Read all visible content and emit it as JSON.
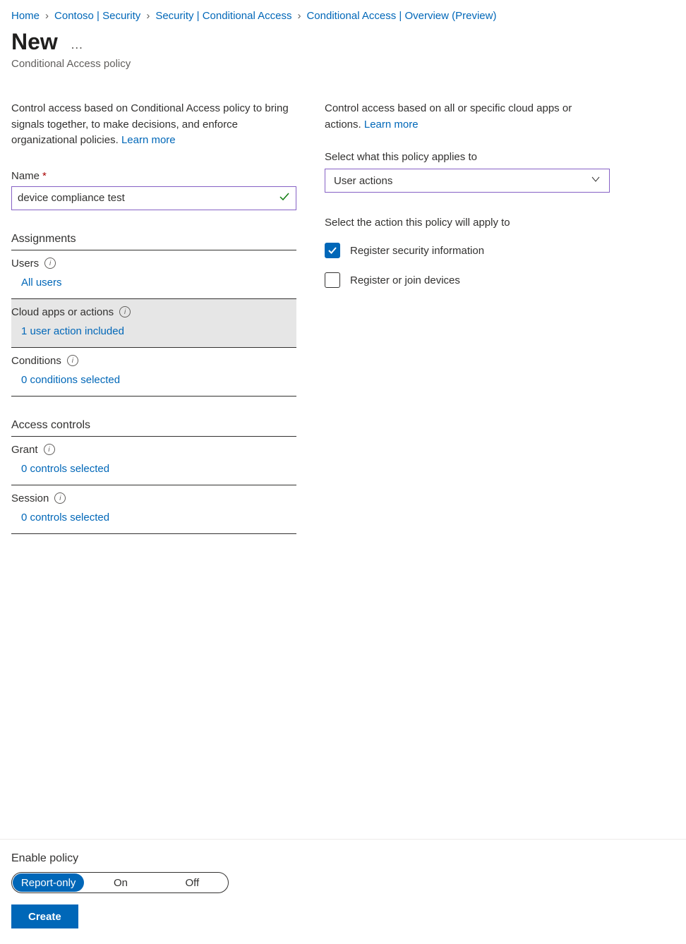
{
  "breadcrumb": {
    "items": [
      "Home",
      "Contoso | Security",
      "Security | Conditional Access",
      "Conditional Access | Overview (Preview)"
    ]
  },
  "header": {
    "title": "New",
    "subtitle": "Conditional Access policy"
  },
  "left": {
    "intro_text": "Control access based on Conditional Access policy to bring signals together, to make decisions, and enforce organizational policies. ",
    "learn_more": "Learn more",
    "name_label": "Name",
    "name_value": "device compliance test",
    "assignments_header": "Assignments",
    "users": {
      "label": "Users",
      "value": "All users"
    },
    "cloud_apps": {
      "label": "Cloud apps or actions",
      "value": "1 user action included"
    },
    "conditions": {
      "label": "Conditions",
      "value": "0 conditions selected"
    },
    "access_controls_header": "Access controls",
    "grant": {
      "label": "Grant",
      "value": "0 controls selected"
    },
    "session": {
      "label": "Session",
      "value": "0 controls selected"
    }
  },
  "right": {
    "intro_text": "Control access based on all or specific cloud apps or actions. ",
    "learn_more": "Learn more",
    "select_label": "Select what this policy applies to",
    "select_value": "User actions",
    "action_label": "Select the action this policy will apply to",
    "actions": [
      {
        "label": "Register security information",
        "checked": true
      },
      {
        "label": "Register or join devices",
        "checked": false
      }
    ]
  },
  "footer": {
    "enable_label": "Enable policy",
    "options": [
      "Report-only",
      "On",
      "Off"
    ],
    "active_index": 0,
    "create_label": "Create"
  }
}
